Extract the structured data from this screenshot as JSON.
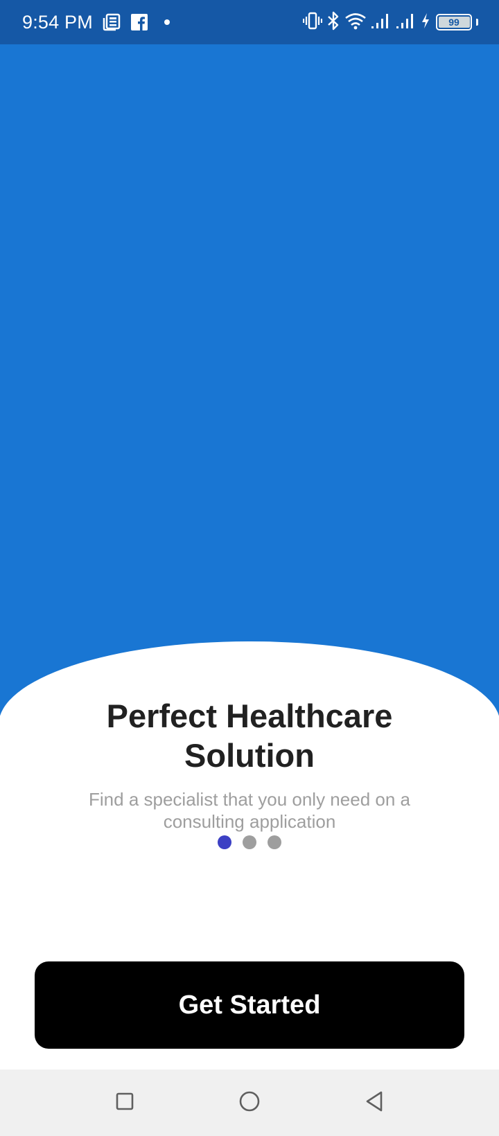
{
  "status_bar": {
    "time": "9:54 PM",
    "left_icons": [
      "news-icon",
      "facebook-icon",
      "dot-icon"
    ],
    "right_icons": [
      "vibrate-icon",
      "bluetooth-icon",
      "wifi-icon",
      "signal-icon",
      "signal-icon",
      "charging-icon",
      "battery-icon"
    ],
    "battery_level": "99"
  },
  "onboarding": {
    "title_line1": "Perfect Healthcare",
    "title_line2": "Solution",
    "subtitle_line1": "Find a specialist that you only need on a",
    "subtitle_line2": "consulting application",
    "page_count": 3,
    "active_page": 0
  },
  "cta": {
    "label": "Get Started"
  },
  "navigation": {
    "buttons": [
      "recents-icon",
      "home-icon",
      "back-icon"
    ]
  },
  "colors": {
    "status_bar": "#1558a6",
    "hero": "#1976d3",
    "active_dot": "#3c40c4",
    "inactive_dot": "#9e9e9e",
    "button": "#000000"
  }
}
